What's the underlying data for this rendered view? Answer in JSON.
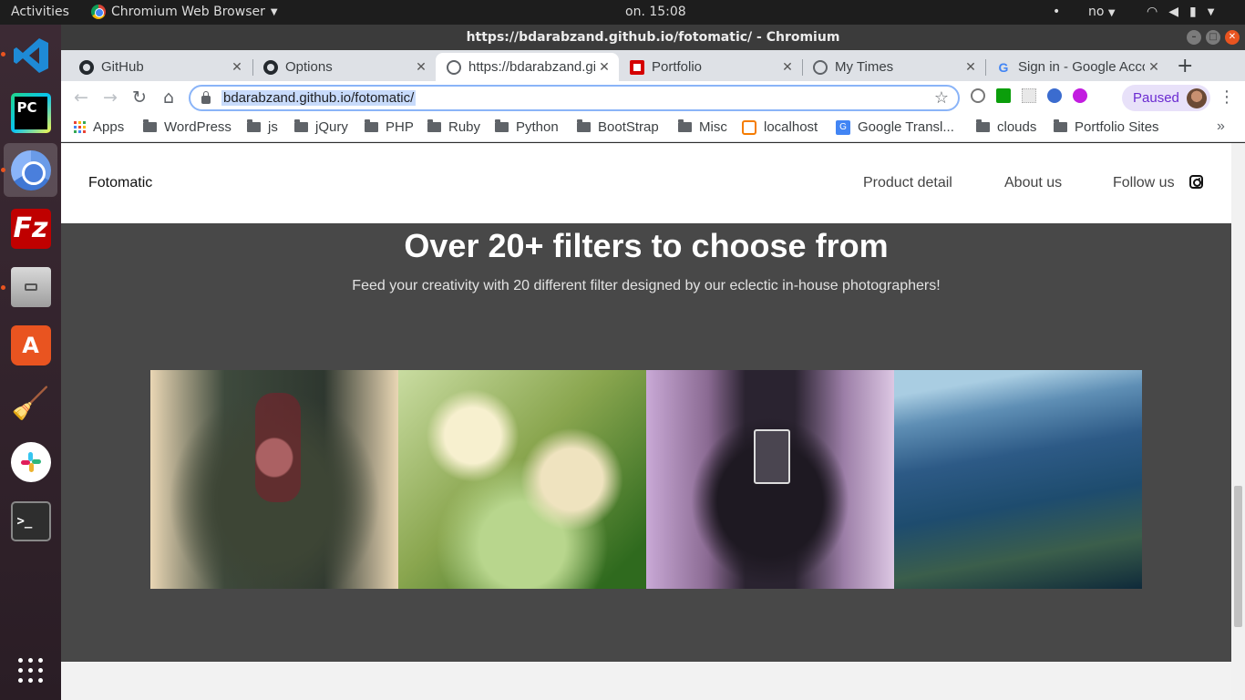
{
  "topbar": {
    "activities": "Activities",
    "app_name": "Chromium Web Browser",
    "clock": "on. 15:08",
    "keyboard_layout": "no",
    "tray_dot": "•"
  },
  "dock": {
    "items": [
      "Visual Studio Code",
      "PyCharm",
      "Chromium",
      "FileZilla",
      "Files",
      "Ubuntu Software",
      "BleachBit",
      "Slack",
      "Terminal",
      "Show Applications"
    ],
    "pycharm_label": "PC",
    "filezilla_label": "Fz",
    "software_label": "A",
    "terminal_label": ">_"
  },
  "window": {
    "title": "https://bdarabzand.github.io/fotomatic/ - Chromium"
  },
  "tabs": [
    {
      "label": "GitHub",
      "favicon": "github-icon"
    },
    {
      "label": "Options",
      "favicon": "github-icon"
    },
    {
      "label": "https://bdarabzand.github.io/fotomatic/",
      "favicon": "globe-icon",
      "active": true
    },
    {
      "label": "Portfolio",
      "favicon": "portfolio-icon"
    },
    {
      "label": "My Times",
      "favicon": "globe-icon"
    },
    {
      "label": "Sign in - Google Accounts",
      "favicon": "google-icon"
    }
  ],
  "toolbar": {
    "url": "bdarabzand.github.io/fotomatic/",
    "profile_status": "Paused"
  },
  "bookmarks": [
    {
      "label": "Apps",
      "icon": "apps-icon"
    },
    {
      "label": "WordPress",
      "icon": "folder-icon"
    },
    {
      "label": "js",
      "icon": "folder-icon"
    },
    {
      "label": "jQury",
      "icon": "folder-icon"
    },
    {
      "label": "PHP",
      "icon": "folder-icon"
    },
    {
      "label": "Ruby",
      "icon": "folder-icon"
    },
    {
      "label": "Python",
      "icon": "folder-icon"
    },
    {
      "label": "BootStrap",
      "icon": "folder-icon"
    },
    {
      "label": "Misc",
      "icon": "folder-icon"
    },
    {
      "label": "localhost",
      "icon": "localhost-icon"
    },
    {
      "label": "Google Transl...",
      "icon": "translate-icon"
    },
    {
      "label": "clouds",
      "icon": "folder-icon"
    },
    {
      "label": "Portfolio Sites",
      "icon": "folder-icon"
    }
  ],
  "site": {
    "brand": "Fotomatic",
    "nav": [
      "Product detail",
      "About us",
      "Follow us"
    ],
    "heading": "Over 20+ filters to choose from",
    "subheading": "Feed your creativity with 20 different filter designed by our eclectic in-house photographers!",
    "gallery": [
      "rose-photo",
      "blossom-photo",
      "camera-photo",
      "mountain-photo"
    ]
  },
  "colors": {
    "accent": "#e95420",
    "filters_background": "#484848",
    "omnibox_focus": "#8ab4f8"
  }
}
